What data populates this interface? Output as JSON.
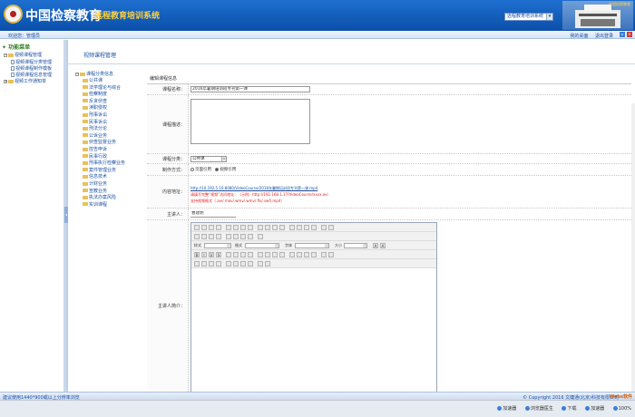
{
  "header": {
    "title_main": "中国检察教育",
    "title_sub": "远程教育培训系统",
    "system_select": "远程教育培训系统",
    "caption": "中国检察教育"
  },
  "subbar": {
    "welcome": "欢迎您：管理员",
    "links": [
      "我的桌面",
      "退出登录"
    ]
  },
  "sidebar": {
    "title": "功能菜单",
    "sections": [
      {
        "label": "视频课程管理",
        "items": [
          "视频课程分类管理",
          "视频课程制作模板",
          "视频课程信息管理"
        ]
      },
      {
        "label": "视频工作通知单",
        "items": []
      }
    ]
  },
  "page": {
    "title": "视频课程管理"
  },
  "category_tree": {
    "root": "课程分类信息",
    "items": [
      "公共课",
      "法学理论与综合",
      "检察制度",
      "反贪侦查",
      "渎职侵权",
      "刑事诉讼",
      "民事诉讼",
      "刑法分论",
      "公诉业务",
      "侦查监督业务",
      "控告申诉",
      "民事行政",
      "刑事执行检察业务",
      "案件管理业务",
      "信息技术",
      "计财业务",
      "宣教业务",
      "执法办案风险",
      "实训课程"
    ]
  },
  "form": {
    "heading": "编辑课程信息",
    "fields": {
      "course_name_label": "课程名称：",
      "course_name_value": "2016年暑期培训班专刊第一课",
      "description_label": "课程描述：",
      "category_label": "课程分类：",
      "category_value": "公共课",
      "method_label": "制作方式：",
      "method_options": [
        "页面引用",
        "视频引用"
      ],
      "method_selected": "视频引用",
      "content_label": "内容地址：",
      "content_url": "http://10.192.5.10:8080/VideoCourse/2016年暑期培训班专刊第一课.mp4",
      "content_hint_1": "请填写完整“视频”访问地址：（示例）http://192.168.1.17/VideoCourse/xxxx.avi",
      "content_hint_2": "支持视频格式（.avi/.mov/.wmv/.wmv/.flv/.swf/.mp4）",
      "lecturer_label": "主讲人：",
      "lecturer_value": "曹建明",
      "lecturer_intro_label": "主讲人简介："
    },
    "editor": {
      "style_label": "样式",
      "format_label": "格式",
      "font_label": "字体",
      "size_label": "大小"
    }
  },
  "footer": {
    "left": "建议使用1440*900或以上分辨率浏览",
    "right": "© Copyright 2016 文婕通(北京)科技有限公司",
    "brand": "Webs软件"
  },
  "taskbar": {
    "items": [
      "加速器",
      "浏览器医生",
      "下载",
      "加速器",
      "100%"
    ]
  },
  "colors": {
    "header_blue": "#0b4fa8",
    "accent_gold": "#ffd23c",
    "link_blue": "#1a4fa0",
    "hint_red": "#d22",
    "menu_green": "#2e7d1f"
  }
}
